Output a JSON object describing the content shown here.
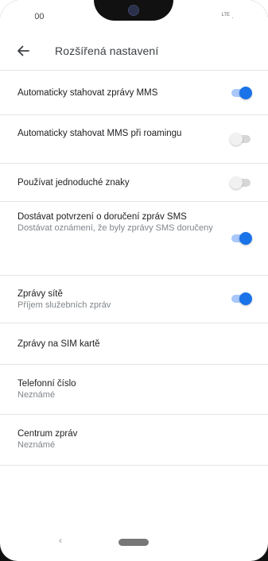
{
  "status_bar": {
    "time": "10:00",
    "network_label": "LTE"
  },
  "app_bar": {
    "back_icon": "arrow-left-icon",
    "title": "Rozšířená nastavení"
  },
  "settings": [
    {
      "title": "Automaticky stahovat zprávy MMS",
      "summary": "",
      "toggle": "on"
    },
    {
      "title": "Automaticky stahovat MMS při roamingu",
      "summary": "",
      "toggle": "off"
    },
    {
      "title": "Používat jednoduché znaky",
      "summary": "",
      "toggle": "off"
    },
    {
      "title": "Dostávat potvrzení o doručení zpráv SMS",
      "summary": "Dostávat oznámení, že byly zprávy SMS doručeny",
      "toggle": "on"
    },
    {
      "title": "Zprávy sítě",
      "summary": "Příjem služebních zpráv",
      "toggle": "on"
    },
    {
      "title": "Zprávy na SIM kartě",
      "summary": "",
      "toggle": null
    },
    {
      "title": "Telefonní číslo",
      "summary": "Neznámé",
      "toggle": null
    },
    {
      "title": "Centrum zpráv",
      "summary": "Neznámé",
      "toggle": null
    }
  ],
  "nav_bar": {
    "back_glyph": "‹",
    "home_icon": "home-pill-icon"
  },
  "colors": {
    "toggle_on_thumb": "#1a73e8",
    "toggle_on_track": "#a8c7fa",
    "toggle_off_thumb": "#f1f1f1",
    "toggle_off_track": "#d7d7d7",
    "divider": "#e4e4e4",
    "summary_text": "#80868b"
  }
}
